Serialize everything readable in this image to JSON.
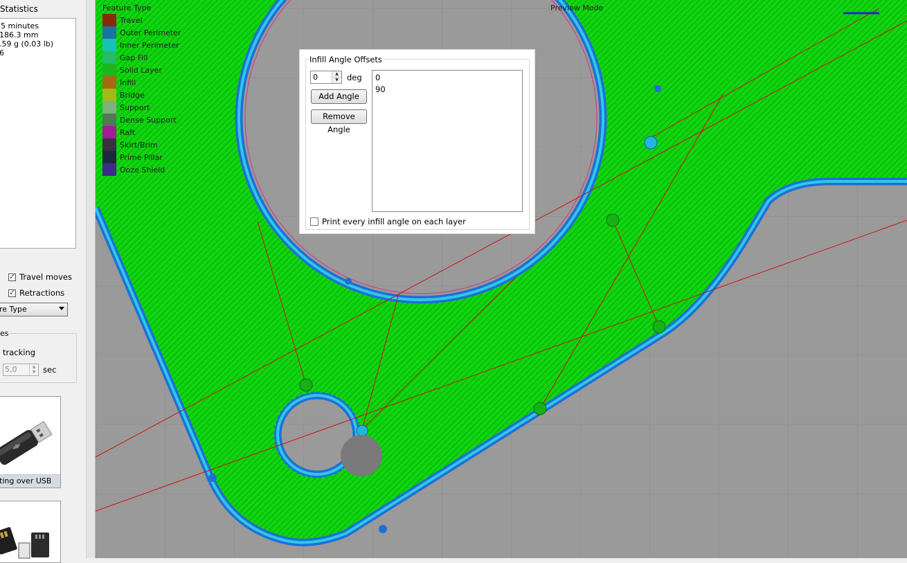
{
  "left_panel": {
    "statistics_title": "Statistics",
    "stats_lines": [
      "5 minutes",
      "186.3 mm",
      ".59 g (0.03 lb)",
      "6"
    ],
    "travel_moves": {
      "label": "Travel moves",
      "checked": true
    },
    "retractions": {
      "label": "Retractions",
      "checked": true
    },
    "color_by_combo": "re Type",
    "group2_title": "es",
    "tracking_label": "tracking",
    "tracking_value": "5,0",
    "tracking_unit": "sec",
    "usb_tile_label": "ting over USB"
  },
  "viewport": {
    "preview_mode": "Preview Mode",
    "legend_title": "Feature Type",
    "legend": [
      {
        "label": "Travel",
        "color": "#8a2a0c"
      },
      {
        "label": "Outer Perimeter",
        "color": "#1a72a6"
      },
      {
        "label": "Inner Perimeter",
        "color": "#19c0b5"
      },
      {
        "label": "Gap Fill",
        "color": "#22bd66"
      },
      {
        "label": "Solid Layer",
        "color": "#1fb51f"
      },
      {
        "label": "Infill",
        "color": "#a66a10"
      },
      {
        "label": "Bridge",
        "color": "#a4b81a"
      },
      {
        "label": "Support",
        "color": "#7cb17c"
      },
      {
        "label": "Dense Support",
        "color": "#4e7a54"
      },
      {
        "label": "Raft",
        "color": "#a21c96"
      },
      {
        "label": "Skirt/Brim",
        "color": "#3a3040"
      },
      {
        "label": "Prime Pillar",
        "color": "#1c2a40"
      },
      {
        "label": "Ooze Shield",
        "color": "#3c2a8c"
      }
    ]
  },
  "dialog": {
    "title": "Infill Angle Offsets",
    "angle_value": "0",
    "angle_unit": "deg",
    "add_button": "Add Angle",
    "remove_button": "Remove Angle",
    "angles": [
      "0",
      "90"
    ],
    "print_every_label": "Print every infill angle on each layer",
    "print_every_checked": false
  },
  "colors": {
    "infill_green": "#0fd60f",
    "perimeter_blue": "#1f6fd6",
    "perimeter_cyan": "#2ec8e8",
    "travel_red": "#d01010",
    "grid_background": "#9a9a9a"
  }
}
